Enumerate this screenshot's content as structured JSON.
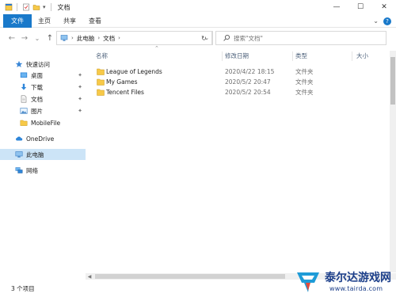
{
  "window": {
    "title": "文档",
    "controls": {
      "minimize": "—",
      "maximize": "☐",
      "close": "✕"
    }
  },
  "quick_access_toolbar": {
    "dropdown": "▾"
  },
  "ribbon": {
    "tabs": [
      "文件",
      "主页",
      "共享",
      "查看"
    ],
    "right": {
      "expand": "⌄",
      "help": "?"
    }
  },
  "nav": {
    "back": "←",
    "forward": "→",
    "recent": "⌄",
    "up": "↑",
    "breadcrumbs": [
      "此电脑",
      "文档"
    ],
    "address_dropdown": "⌄",
    "refresh": "↻",
    "search": {
      "placeholder": "搜索\"文档\"",
      "value": ""
    }
  },
  "sidebar": {
    "items": [
      {
        "label": "快速访问",
        "icon": "star-icon",
        "pinned": false
      },
      {
        "label": "桌面",
        "icon": "desktop-icon",
        "pinned": true
      },
      {
        "label": "下载",
        "icon": "download-icon",
        "pinned": true
      },
      {
        "label": "文档",
        "icon": "document-icon",
        "pinned": true
      },
      {
        "label": "图片",
        "icon": "picture-icon",
        "pinned": true
      },
      {
        "label": "MobileFile",
        "icon": "folder-icon",
        "pinned": false
      },
      {
        "label": "OneDrive",
        "icon": "cloud-icon",
        "pinned": false
      },
      {
        "label": "此电脑",
        "icon": "computer-icon",
        "pinned": false,
        "selected": true
      },
      {
        "label": "网络",
        "icon": "network-icon",
        "pinned": false
      }
    ],
    "pin_glyph": "✦"
  },
  "columns": {
    "sort_indicator": "⌃",
    "headers": [
      "名称",
      "修改日期",
      "类型",
      "大小"
    ]
  },
  "files": [
    {
      "name": "League of Legends",
      "modified": "2020/4/22 18:15",
      "type": "文件夹",
      "size": ""
    },
    {
      "name": "My Games",
      "modified": "2020/5/2 20:47",
      "type": "文件夹",
      "size": ""
    },
    {
      "name": "Tencent Files",
      "modified": "2020/5/2 20:54",
      "type": "文件夹",
      "size": ""
    }
  ],
  "status": {
    "item_count": "3 个项目"
  },
  "colors": {
    "accent": "#1979ca",
    "selection": "#cce4f7",
    "folder": "#f7c948",
    "header_text": "#4c607a",
    "watermark": "#1c3f8a"
  },
  "watermark": {
    "title": "泰尔达游戏网",
    "url": "www.tairda.com"
  }
}
